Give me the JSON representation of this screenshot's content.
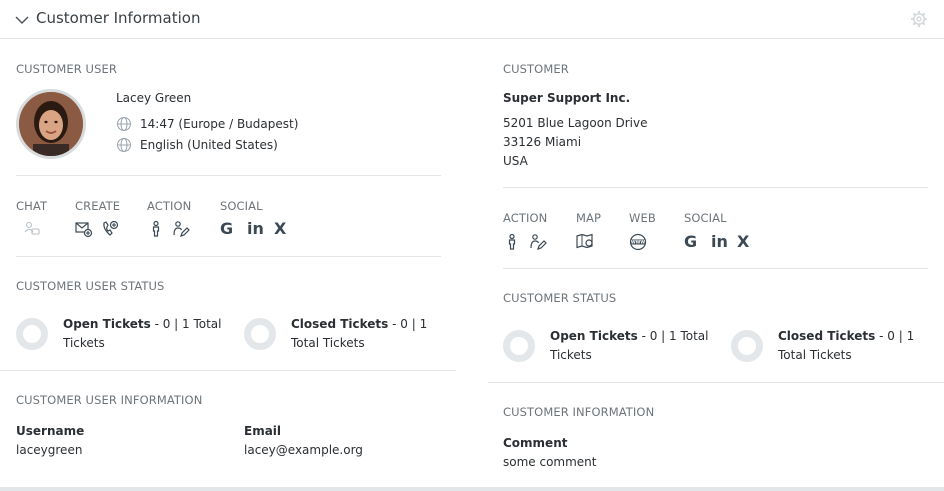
{
  "widget": {
    "title": "Customer Information"
  },
  "customer_user": {
    "section_title": "CUSTOMER USER",
    "name": "Lacey Green",
    "time": "14:47 (Europe / Budapest)",
    "language": "English (United States)"
  },
  "customer_user_actions": {
    "chat_label": "CHAT",
    "create_label": "CREATE",
    "action_label": "ACTION",
    "social_label": "SOCIAL"
  },
  "customer_user_status": {
    "section_title": "CUSTOMER USER STATUS",
    "open_label": "Open Tickets",
    "open_value": " - 0 | 1 Total Tickets",
    "closed_label": "Closed Tickets",
    "closed_value": " - 0 | 1 Total Tickets"
  },
  "customer_user_information": {
    "section_title": "CUSTOMER USER INFORMATION",
    "username_label": "Username",
    "username_value": "laceygreen",
    "email_label": "Email",
    "email_value": "lacey@example.org"
  },
  "customer": {
    "section_title": "CUSTOMER",
    "name": "Super Support Inc.",
    "street": "5201 Blue Lagoon Drive",
    "city": "33126 Miami",
    "country": "USA"
  },
  "customer_actions": {
    "action_label": "ACTION",
    "map_label": "MAP",
    "web_label": "WEB",
    "social_label": "SOCIAL"
  },
  "customer_status": {
    "section_title": "CUSTOMER STATUS",
    "open_label": "Open Tickets",
    "open_value": " - 0 | 1 Total Tickets",
    "closed_label": "Closed Tickets",
    "closed_value": " - 0 | 1 Total Tickets"
  },
  "customer_information": {
    "section_title": "CUSTOMER INFORMATION",
    "comment_label": "Comment",
    "comment_value": "some comment"
  },
  "icons": {
    "social_google": "G",
    "social_linkedin": "in",
    "social_xing": "X"
  },
  "colors": {
    "icon": "#3c4954",
    "muted_icon": "#9aa3ab",
    "ring": "#e4e7ea"
  }
}
